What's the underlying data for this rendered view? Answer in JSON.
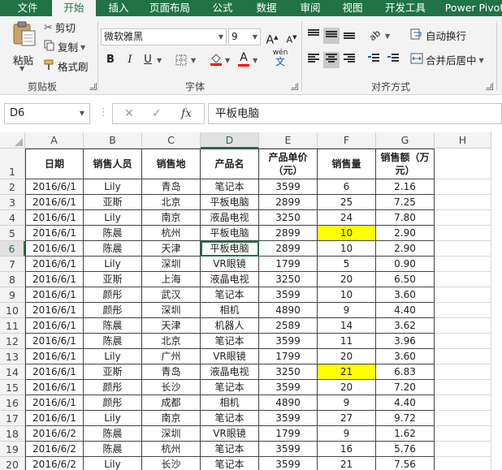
{
  "tabs": [
    "文件",
    "开始",
    "插入",
    "页面布局",
    "公式",
    "数据",
    "审阅",
    "视图",
    "开发工具",
    "Power Pivot"
  ],
  "active_tab": "开始",
  "ribbon": {
    "clipboard": {
      "paste": "粘贴",
      "cut": "剪切",
      "copy": "复制",
      "format_painter": "格式刷",
      "label": "剪贴板"
    },
    "font": {
      "name": "微软雅黑",
      "size": "9",
      "grow": "A",
      "shrink": "A",
      "bold": "B",
      "italic": "I",
      "underline": "U",
      "wen": "wén",
      "wen_char": "文",
      "label": "字体"
    },
    "alignment": {
      "wrap_text": "自动换行",
      "merge_center": "合并后居中",
      "label": "对齐方式"
    }
  },
  "formula_bar": {
    "name_box": "D6",
    "cancel": "✕",
    "enter": "✓",
    "fx": "fx",
    "value": "平板电脑"
  },
  "colors": {
    "accent": "#217346",
    "highlight": "#ffff00"
  },
  "columns": [
    "A",
    "B",
    "C",
    "D",
    "E",
    "F",
    "G",
    "H"
  ],
  "row_numbers": [
    "1",
    "2",
    "3",
    "4",
    "5",
    "6",
    "7",
    "8",
    "9",
    "10",
    "11",
    "12",
    "13",
    "14",
    "15",
    "16",
    "17",
    "18",
    "19",
    "20"
  ],
  "header_row": [
    "日期",
    "销售人员",
    "销售地",
    "产品名",
    "产品单价（元）",
    "销售量",
    "销售额（万元）"
  ],
  "rows": [
    [
      "2016/6/1",
      "Lily",
      "青岛",
      "笔记本",
      "3599",
      "6",
      "2.16"
    ],
    [
      "2016/6/1",
      "亚斯",
      "北京",
      "平板电脑",
      "2899",
      "25",
      "7.25"
    ],
    [
      "2016/6/1",
      "Lily",
      "南京",
      "液晶电视",
      "3250",
      "24",
      "7.80"
    ],
    [
      "2016/6/1",
      "陈晨",
      "杭州",
      "平板电脑",
      "2899",
      "10",
      "2.90"
    ],
    [
      "2016/6/1",
      "陈晨",
      "天津",
      "平板电脑",
      "2899",
      "10",
      "2.90"
    ],
    [
      "2016/6/1",
      "Lily",
      "深圳",
      "VR眼镜",
      "1799",
      "5",
      "0.90"
    ],
    [
      "2016/6/1",
      "亚斯",
      "上海",
      "液晶电视",
      "3250",
      "20",
      "6.50"
    ],
    [
      "2016/6/1",
      "颜彤",
      "武汉",
      "笔记本",
      "3599",
      "10",
      "3.60"
    ],
    [
      "2016/6/1",
      "颜彤",
      "深圳",
      "相机",
      "4890",
      "9",
      "4.40"
    ],
    [
      "2016/6/1",
      "陈晨",
      "天津",
      "机器人",
      "2589",
      "14",
      "3.62"
    ],
    [
      "2016/6/1",
      "陈晨",
      "北京",
      "笔记本",
      "3599",
      "11",
      "3.96"
    ],
    [
      "2016/6/1",
      "Lily",
      "广州",
      "VR眼镜",
      "1799",
      "20",
      "3.60"
    ],
    [
      "2016/6/1",
      "亚斯",
      "青岛",
      "液晶电视",
      "3250",
      "21",
      "6.83"
    ],
    [
      "2016/6/1",
      "颜彤",
      "长沙",
      "笔记本",
      "3599",
      "20",
      "7.20"
    ],
    [
      "2016/6/1",
      "颜彤",
      "成都",
      "相机",
      "4890",
      "9",
      "4.40"
    ],
    [
      "2016/6/1",
      "Lily",
      "南京",
      "笔记本",
      "3599",
      "27",
      "9.72"
    ],
    [
      "2016/6/2",
      "陈晨",
      "深圳",
      "VR眼镜",
      "1799",
      "9",
      "1.62"
    ],
    [
      "2016/6/2",
      "陈晨",
      "杭州",
      "笔记本",
      "3599",
      "16",
      "5.76"
    ],
    [
      "2016/6/2",
      "Lily",
      "长沙",
      "笔记本",
      "3599",
      "21",
      "7.56"
    ]
  ],
  "highlighted_cells": [
    "F5",
    "F14"
  ],
  "active_cell": "D6"
}
